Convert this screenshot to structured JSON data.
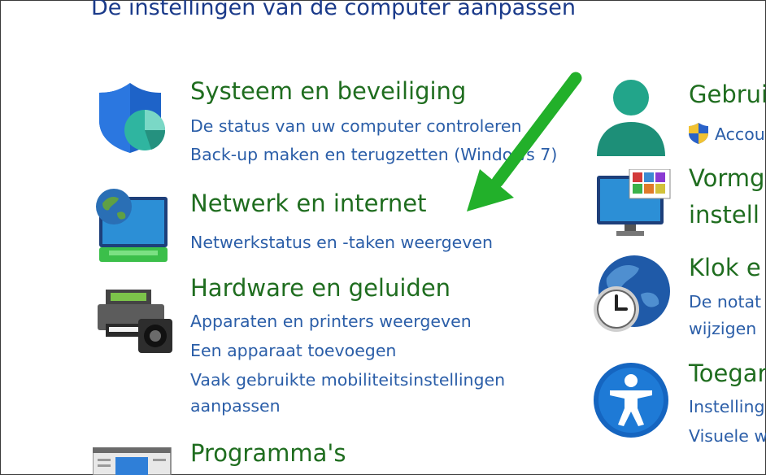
{
  "page": {
    "title": "De instellingen van de computer aanpassen"
  },
  "left_column": {
    "system": {
      "title": "Systeem en beveiliging",
      "links": [
        "De status van uw computer controleren",
        "Back-up maken en terugzetten (Windows 7)"
      ]
    },
    "network": {
      "title": "Netwerk en internet",
      "links": [
        "Netwerkstatus en -taken weergeven"
      ]
    },
    "hardware": {
      "title": "Hardware en geluiden",
      "links": [
        "Apparaten en printers weergeven",
        "Een apparaat toevoegen",
        "Vaak gebruikte mobiliteitsinstellingen",
        "aanpassen"
      ]
    },
    "programs": {
      "title": "Programma's"
    }
  },
  "right_column": {
    "users": {
      "title": "Gebrui",
      "links": [
        "Accou"
      ]
    },
    "appearance": {
      "title_line1": "Vormg",
      "title_line2": "instell"
    },
    "clock": {
      "title": "Klok e",
      "links": [
        "De notat",
        "wijzigen"
      ]
    },
    "access": {
      "title": "Toegar",
      "links": [
        "Instelling",
        "Visuele w"
      ]
    }
  },
  "colors": {
    "category_title": "#1f6d1f",
    "link": "#2b5ea8",
    "page_title": "#1a3a8a",
    "annotation_arrow": "#22b02a"
  },
  "icons": [
    "shield-icon",
    "network-monitor-icon",
    "printer-icon",
    "programs-window-icon",
    "user-icon",
    "uac-shield-icon",
    "appearance-monitor-icon",
    "clock-globe-icon",
    "accessibility-icon"
  ]
}
